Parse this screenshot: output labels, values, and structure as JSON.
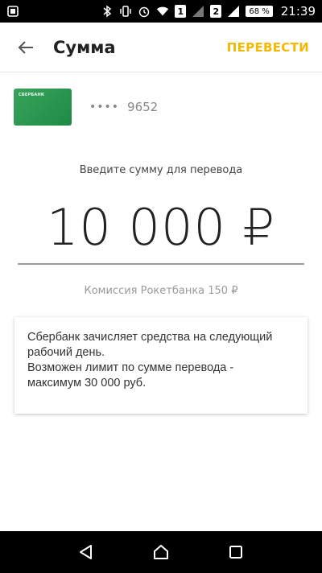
{
  "status_bar": {
    "sim1": "1",
    "sim2": "2",
    "battery": "68 %",
    "time": "21:39"
  },
  "header": {
    "title": "Сумма",
    "action_label": "ПЕРЕВЕСТИ",
    "accent_color": "#f5b800"
  },
  "card": {
    "brand": "СБЕРБАНК",
    "mask": "••••",
    "last4": "9652",
    "color": "#2e9a52"
  },
  "amount_section": {
    "prompt": "Введите сумму для перевода",
    "amount": "10 000 ₽",
    "commission": "Комиссия Рокетбанка 150 ₽"
  },
  "info": {
    "line1": "Сбербанк зачисляет средства на следующий",
    "line2": "рабочий день.",
    "line3": "Возможен лимит по сумме перевода -",
    "line4": "максимум 30 000 руб."
  },
  "icons": {
    "back": "arrow-left-icon",
    "nav_back": "triangle-back-icon",
    "nav_home": "circle-home-icon",
    "nav_recents": "square-recents-icon"
  }
}
